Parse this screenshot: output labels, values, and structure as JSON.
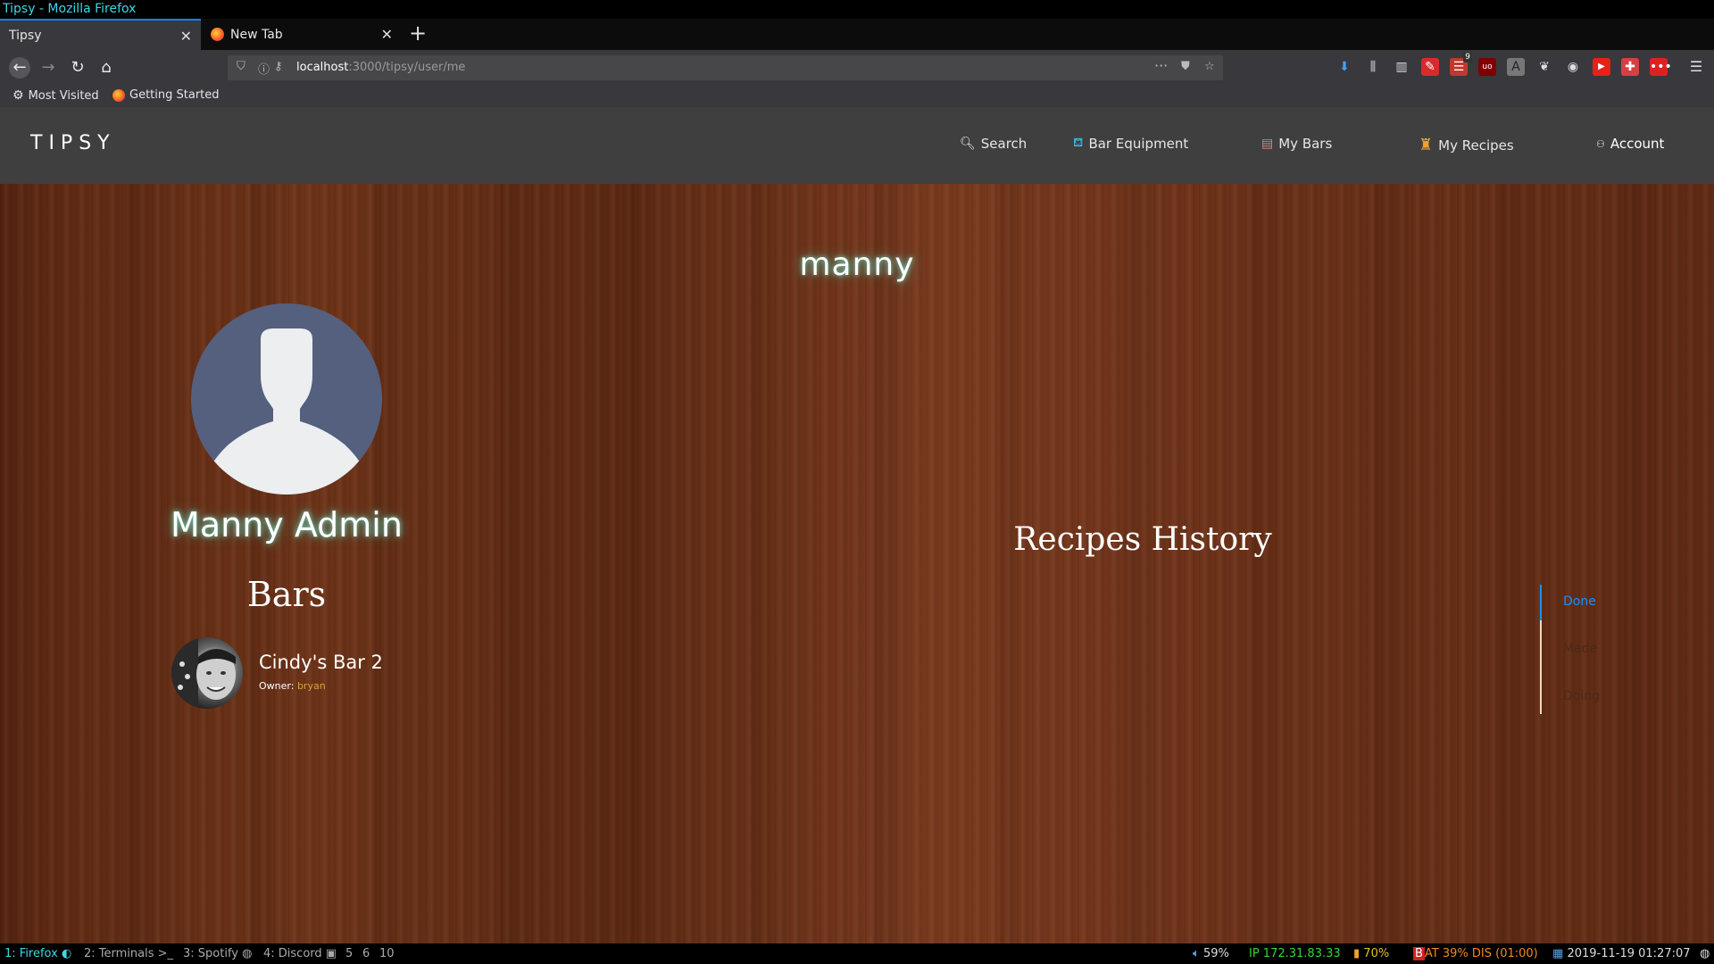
{
  "window": {
    "title": "Tipsy - Mozilla Firefox"
  },
  "browser": {
    "tabs": [
      {
        "label": "Tipsy",
        "active": true
      },
      {
        "label": "New Tab",
        "active": false
      }
    ],
    "url": {
      "host": "localhost",
      "rest": ":3000/tipsy/user/me"
    },
    "bookmarks": [
      {
        "label": "Most Visited",
        "icon": "gear-icon"
      },
      {
        "label": "Getting Started",
        "icon": "firefox-icon"
      }
    ],
    "toolbar_badge": "9"
  },
  "site": {
    "logo": "TIPSY",
    "nav": [
      {
        "label": "Search",
        "icon": "search-icon"
      },
      {
        "label": "Bar Equipment",
        "icon": "bar-equipment-icon"
      },
      {
        "label": "My Bars",
        "icon": "my-bars-icon"
      },
      {
        "label": "My Recipes",
        "icon": "my-recipes-icon"
      },
      {
        "label": "Account",
        "icon": "account-icon"
      }
    ]
  },
  "profile": {
    "username": "manny",
    "full_name": "Manny Admin",
    "bars_heading": "Bars",
    "bars": [
      {
        "name": "Cindy's Bar 2",
        "owner_label": "Owner:",
        "owner": "bryan"
      }
    ],
    "recipes_heading": "Recipes History",
    "history_tabs": [
      {
        "label": "Done",
        "active": true
      },
      {
        "label": "Made",
        "active": false
      },
      {
        "label": "Doing",
        "active": false
      }
    ]
  },
  "taskbar": {
    "workspaces": [
      "1: Firefox",
      "2: Terminals",
      "3: Spotify",
      "4: Discord",
      "5",
      "6",
      "10"
    ],
    "volume": "59%",
    "ip": "IP 172.31.83.33",
    "wifi": "70%",
    "battery": "AT 39% DIS (01:00)",
    "datetime": "2019-11-19 01:27:07"
  },
  "colors": {
    "accent": "#1890ff",
    "owner_link": "#d9a23a",
    "glow": "#3cdcc8",
    "header_bg": "#3f3f3f"
  }
}
